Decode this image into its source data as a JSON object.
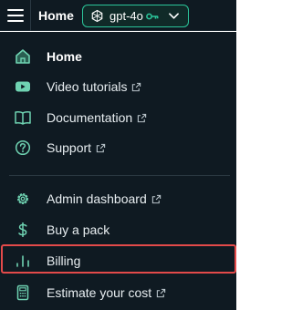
{
  "topbar": {
    "title": "Home",
    "model": {
      "name": "gpt-4o",
      "icon": "openai-icon",
      "accent": "#2bc59a"
    }
  },
  "menu": {
    "items": [
      {
        "label": "Home",
        "icon": "home-icon",
        "active": true,
        "external": false
      },
      {
        "label": "Video tutorials",
        "icon": "youtube-icon",
        "external": true
      },
      {
        "label": "Documentation",
        "icon": "book-icon",
        "external": true
      },
      {
        "label": "Support",
        "icon": "question-circle-icon",
        "external": true
      },
      {
        "label": "Admin dashboard",
        "icon": "gear-icon",
        "external": true
      },
      {
        "label": "Buy a pack",
        "icon": "dollar-icon",
        "external": false
      },
      {
        "label": "Billing",
        "icon": "bar-chart-icon",
        "external": false,
        "highlighted": true
      },
      {
        "label": "Estimate your cost",
        "icon": "calculator-icon",
        "external": true
      }
    ]
  },
  "colors": {
    "background": "#0f1a22",
    "text": "#e8eef1",
    "icon": "#6fd3b2",
    "highlight_border": "#e34a4a"
  }
}
